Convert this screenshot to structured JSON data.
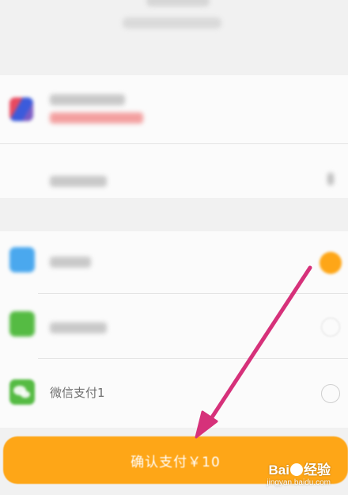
{
  "payment_methods": [
    {
      "label": "",
      "icon": "alipay-icon",
      "selected": true
    },
    {
      "label": "",
      "icon": "wechat-pay-icon",
      "selected": false
    },
    {
      "label": "微信支付1",
      "icon": "wechat-pay-icon",
      "selected": false
    }
  ],
  "confirm_button": {
    "label": "确认支付￥10"
  },
  "watermark": {
    "main": "Bai",
    "main_end": "经验",
    "sub": "jingyan.baidu.com"
  },
  "colors": {
    "accent": "#fea617",
    "arrow": "#d6317a",
    "alipay": "#4aa8ee",
    "wechat": "#55bb43"
  }
}
